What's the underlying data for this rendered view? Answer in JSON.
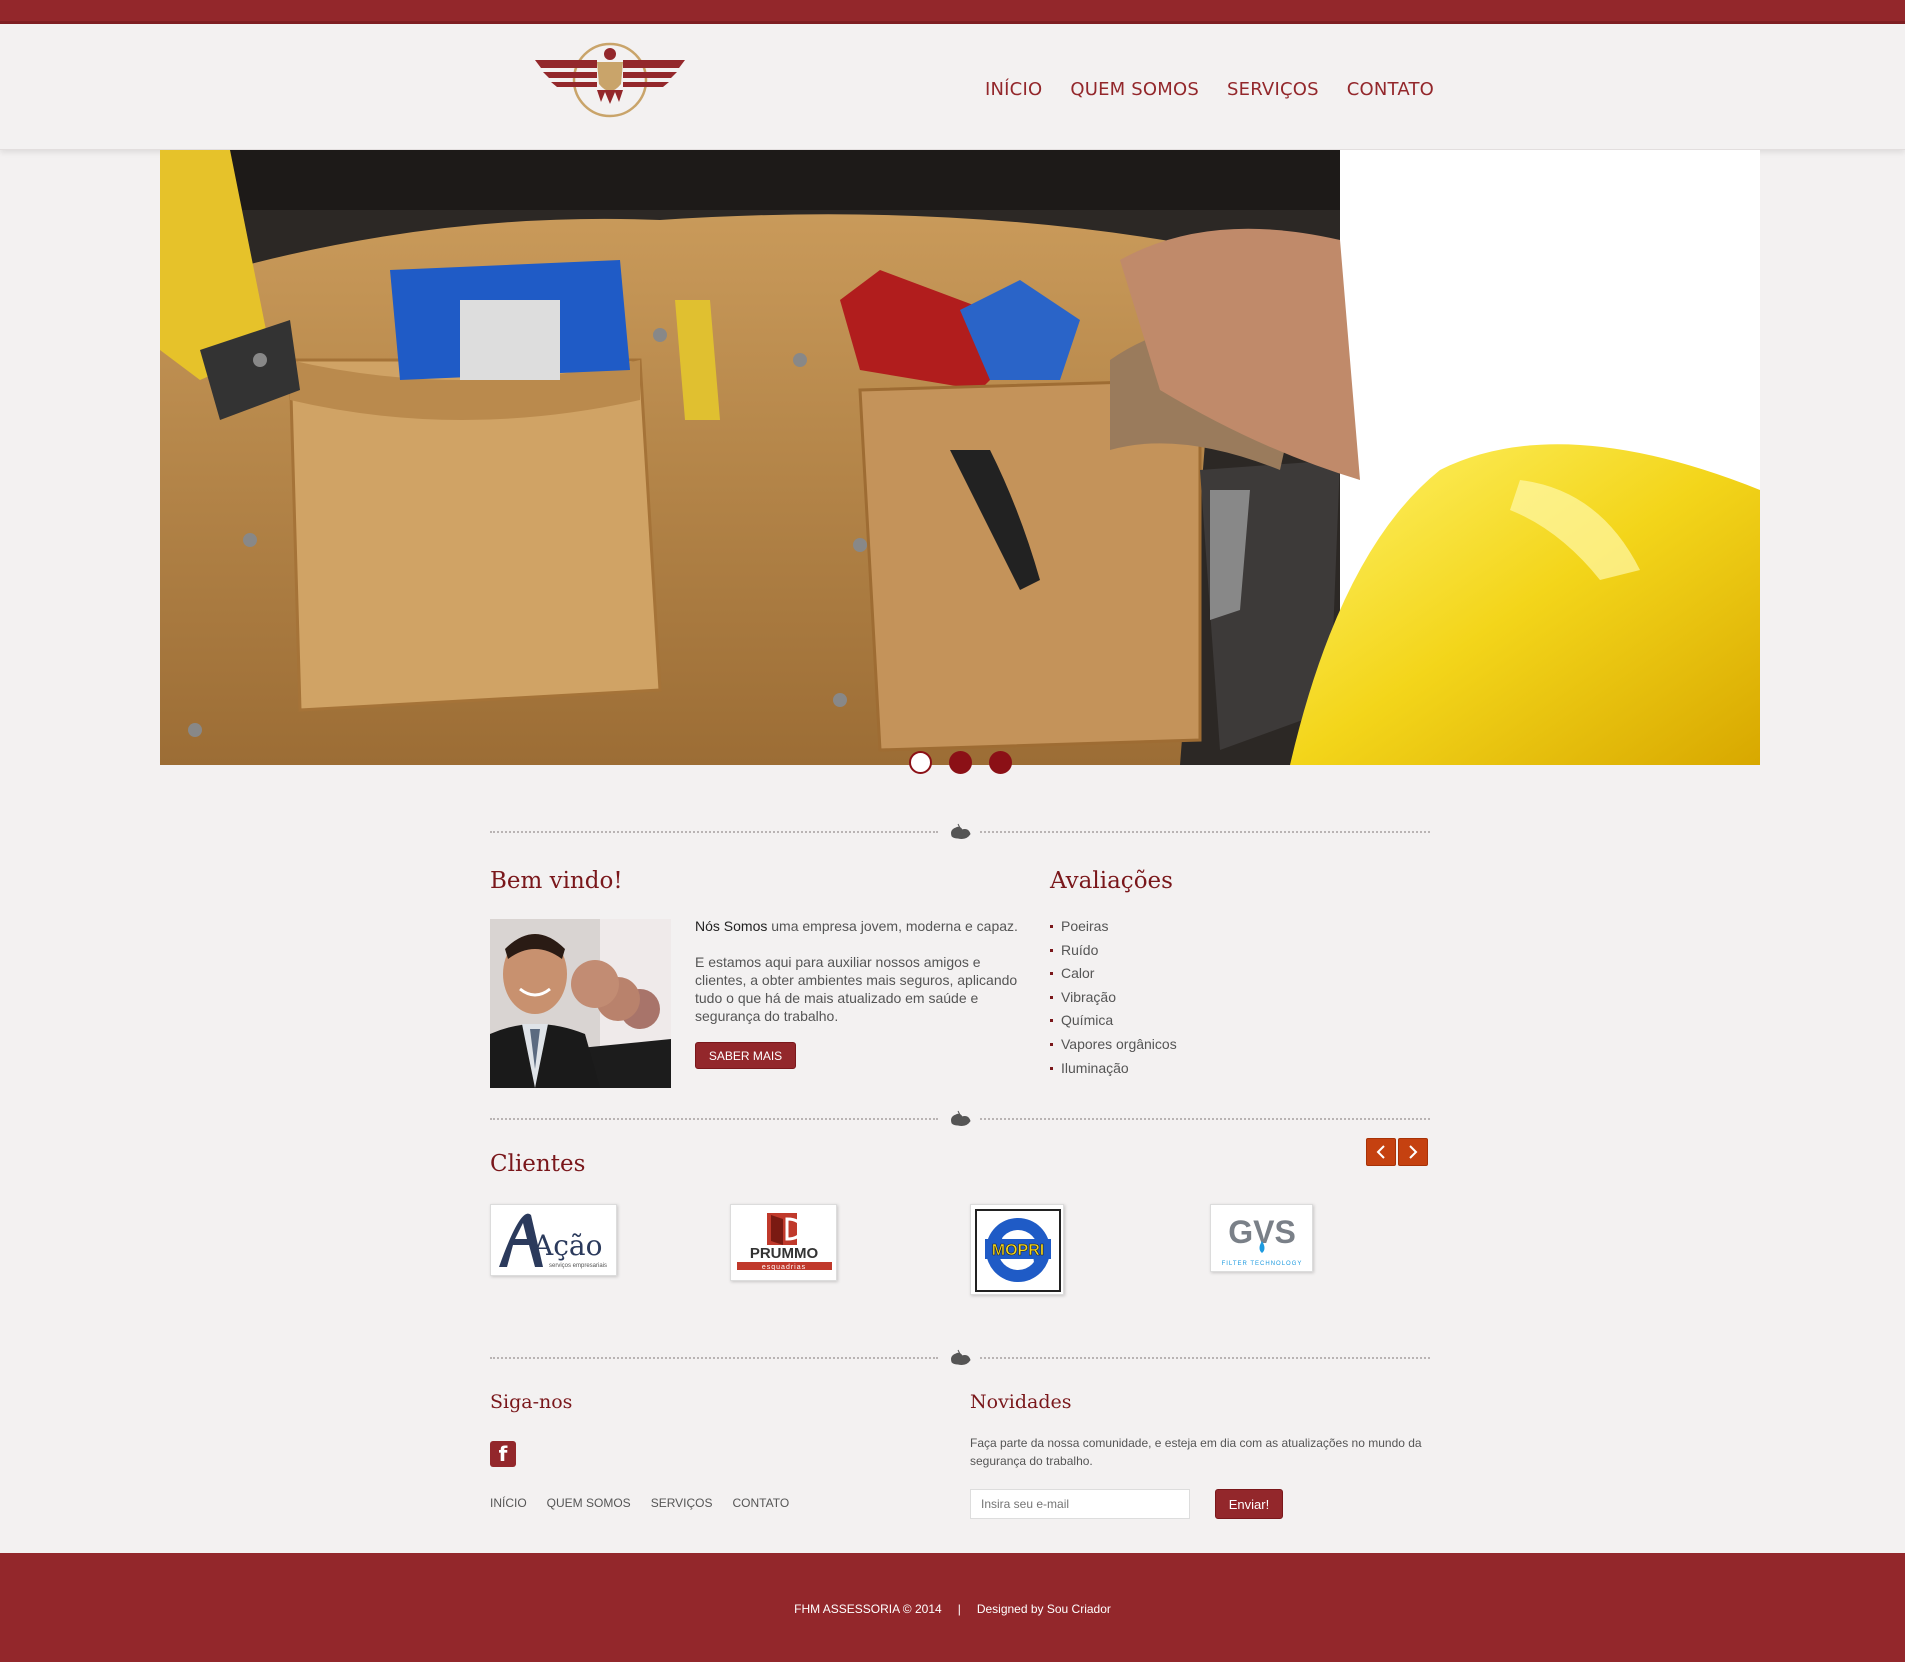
{
  "nav": {
    "items": [
      "INÍCIO",
      "QUEM SOMOS",
      "SERVIÇOS",
      "CONTATO"
    ]
  },
  "slider": {
    "slide_count": 3,
    "active_index": 0
  },
  "welcome": {
    "title": "Bem vindo!",
    "intro_strong": "Nós Somos",
    "intro_rest": " uma empresa jovem, moderna e capaz.",
    "body": "E estamos aqui para auxiliar nossos amigos e clientes, a obter ambientes mais seguros, aplicando tudo o que há de mais atualizado em saúde e segurança do trabalho.",
    "button": "SABER MAIS"
  },
  "avaliacoes": {
    "title": "Avaliações",
    "items": [
      "Poeiras",
      "Ruído",
      "Calor",
      "Vibração",
      "Química",
      "Vapores orgânicos",
      "Iluminação"
    ]
  },
  "clientes": {
    "title": "Clientes",
    "logos": [
      {
        "name": "Ação",
        "subtitle": "serviços empresariais"
      },
      {
        "name": "PRUMMO",
        "subtitle": "esquadrias"
      },
      {
        "name": "MOPRI"
      },
      {
        "name": "GVS",
        "subtitle": "FILTER TECHNOLOGY"
      }
    ]
  },
  "siga": {
    "title": "Siga-nos",
    "links": [
      "INÍCIO",
      "QUEM SOMOS",
      "SERVIÇOS",
      "CONTATO"
    ]
  },
  "novidades": {
    "title": "Novidades",
    "text": "Faça parte da nossa comunidade, e esteja em dia com as atualizações no mundo da segurança do trabalho.",
    "email_placeholder": "Insira seu e-mail",
    "button": "Enviar!"
  },
  "footer": {
    "copyright": "FHM ASSESSORIA © 2014",
    "separator": "|",
    "designed": "Designed by Sou Criador"
  },
  "colors": {
    "brand": "#93272b",
    "title": "#7a171b",
    "arrow": "#c54110"
  }
}
